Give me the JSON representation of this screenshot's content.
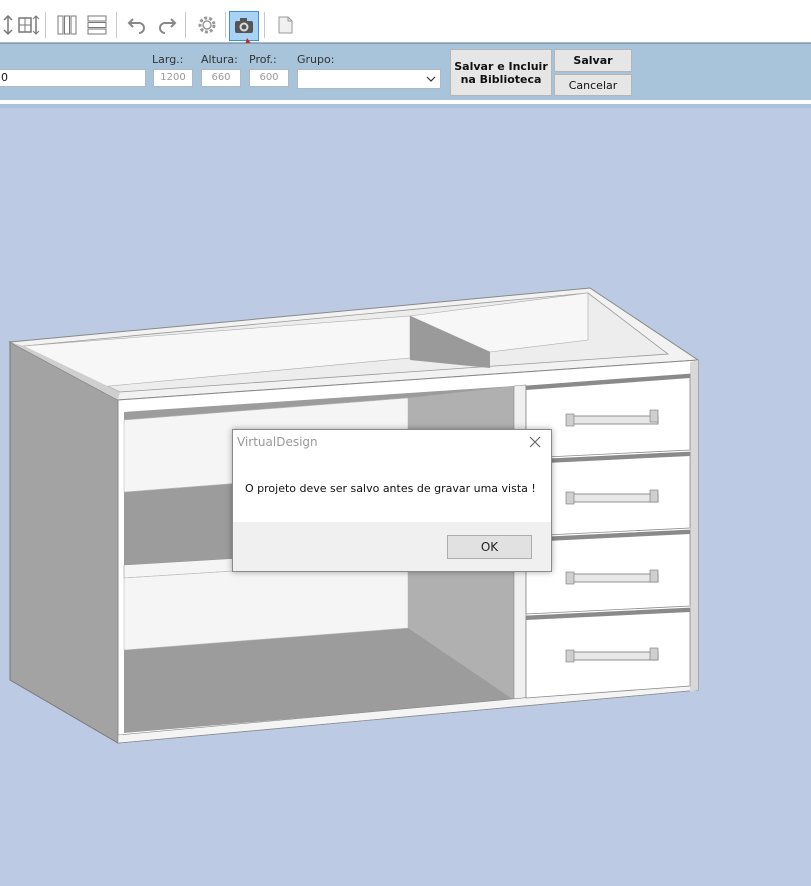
{
  "toolbar": {
    "icons": [
      "height-adjust-icon",
      "width-height-adjust-icon",
      "vertical-divisions-icon",
      "horizontal-divisions-icon",
      "undo-icon",
      "redo-icon",
      "settings-gear-icon",
      "camera-icon",
      "page-icon"
    ],
    "active_icon": "camera-icon",
    "active_color": "#a9d3f5"
  },
  "properties": {
    "name_value": "0",
    "width_label": "Larg.:",
    "width_value": "1200",
    "height_label": "Altura:",
    "height_value": "660",
    "depth_label": "Prof.:",
    "depth_value": "600",
    "group_label": "Grupo:",
    "group_value": "",
    "save_include_label_line1": "Salvar e Incluir",
    "save_include_label_line2": "na Biblioteca",
    "save_label": "Salvar",
    "cancel_label": "Cancelar"
  },
  "viewport": {
    "background": "#bccbe3",
    "object": "3d-cabinet-with-drawers"
  },
  "dialog": {
    "title": "VirtualDesign",
    "message": "O projeto deve ser salvo antes de gravar uma vista !",
    "ok_label": "OK"
  }
}
